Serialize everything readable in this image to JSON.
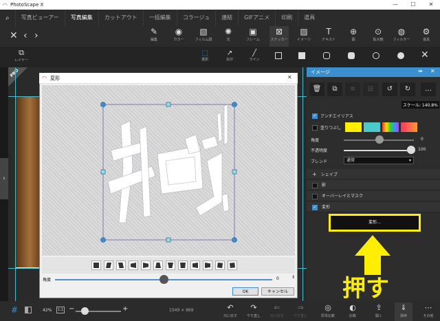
{
  "app": {
    "title": "PhotoScape X",
    "minimize": "—",
    "maximize": "☐",
    "close": "✕"
  },
  "menu": [
    "写真ビューアー",
    "写真編集",
    "カットアウト",
    "一括編集",
    "コラージュ",
    "連結",
    "GIFアニメ",
    "印刷",
    "道具"
  ],
  "active_menu": "写真編集",
  "toolbar": [
    {
      "icon": "✎",
      "label": "編集"
    },
    {
      "icon": "◉",
      "label": "カラー"
    },
    {
      "icon": "▧",
      "label": "フィルム調"
    },
    {
      "icon": "✺",
      "label": "光"
    },
    {
      "icon": "▣",
      "label": "フレーム"
    },
    {
      "icon": "⊠",
      "label": "ステッカー"
    },
    {
      "icon": "▨",
      "label": "イメージ"
    },
    {
      "icon": "T",
      "label": "テキスト"
    },
    {
      "icon": "⊕",
      "label": "図"
    },
    {
      "icon": "⊙",
      "label": "拡大鏡"
    },
    {
      "icon": "◍",
      "label": "フィルター"
    },
    {
      "icon": "⚙",
      "label": "道具"
    }
  ],
  "subtools": [
    {
      "icon": "⬚",
      "label": "選択"
    },
    {
      "icon": "↗",
      "label": "矢印"
    },
    {
      "icon": "╱",
      "label": "ライン"
    }
  ],
  "layer_label": "レイヤー",
  "pro_badge": "PRO",
  "panel": {
    "title": "イメージ",
    "scale_label": "スケール: 140.8%",
    "antialias": "アンチエイリアス",
    "fill": "塗りつぶし",
    "angle_label": "角度",
    "angle_value": "0",
    "opacity_label": "不透明度",
    "opacity_value": "100",
    "blend_label": "ブレンド",
    "blend_value": "通常",
    "shadow": "シェイプ",
    "shadow2": "影",
    "overlay": "オーバーレイとマスク",
    "transform": "変形",
    "transform_button": "変形..."
  },
  "dialog": {
    "title": "変形",
    "angle_label": "角度",
    "angle_value": "0",
    "ok": "OK",
    "cancel": "キャンセル",
    "close": "✕"
  },
  "bottom": {
    "zoom": "42%",
    "ratio": "1:1",
    "size": "1549 × 969",
    "buttons": [
      {
        "icon": "↶",
        "label": "元に戻す"
      },
      {
        "icon": "↷",
        "label": "やり直し"
      },
      {
        "icon": "⇐",
        "label": "元に戻す"
      },
      {
        "icon": "⇒",
        "label": "やり直し"
      },
      {
        "icon": "◎",
        "label": "原本比較"
      },
      {
        "icon": "◐",
        "label": "比較"
      },
      {
        "icon": "⇪",
        "label": "開く"
      },
      {
        "icon": "⇓",
        "label": "保存"
      },
      {
        "icon": "⋯",
        "label": "その他"
      }
    ]
  },
  "annotation": "押す",
  "colors": {
    "accent": "#3a8fd0",
    "highlight": "#ffee00",
    "guide": "#3fbfd0"
  }
}
